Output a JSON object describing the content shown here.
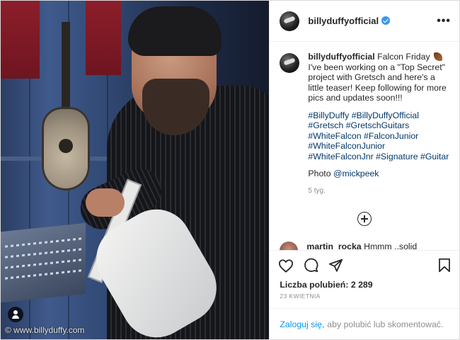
{
  "photo": {
    "watermark": "© www.billyduffy.com",
    "tag_icon": "person-tag-icon"
  },
  "header": {
    "username": "billyduffyofficial",
    "verified_icon": "verified-badge-icon",
    "more_label": "•••"
  },
  "caption": {
    "username": "billyduffyofficial",
    "line1": "Falcon Friday",
    "emoji_icon": "guitar-emoji-icon",
    "body": "I've been working on a \"Top Secret\" project with Gretsch and here's a little teaser! Keep following for more pics and updates soon!!!",
    "hashtags": [
      "#BillyDuffy",
      "#BillyDuffyOfficial",
      "#Gretsch",
      "#GretschGuitars",
      "#WhiteFalcon",
      "#FalconJunior",
      "#WhiteFalconJunior",
      "#WhiteFalconJnr",
      "#Signature",
      "#Guitar"
    ],
    "photo_credit_prefix": "Photo ",
    "photo_credit_mention": "@mickpeek",
    "time_ago": "5 tyg."
  },
  "load_more_icon": "plus-circle-icon",
  "comment": {
    "username": "martin_rocka",
    "text": "Hmmm ..solid"
  },
  "actions": {
    "like_icon": "heart-icon",
    "comment_icon": "comment-icon",
    "share_icon": "share-icon",
    "save_icon": "bookmark-icon"
  },
  "likes": {
    "label": "Liczba polubień: 2 289"
  },
  "date": "23 KWIETNIA",
  "login": {
    "link": "Zaloguj się,",
    "text": "aby polubić lub skomentować."
  }
}
